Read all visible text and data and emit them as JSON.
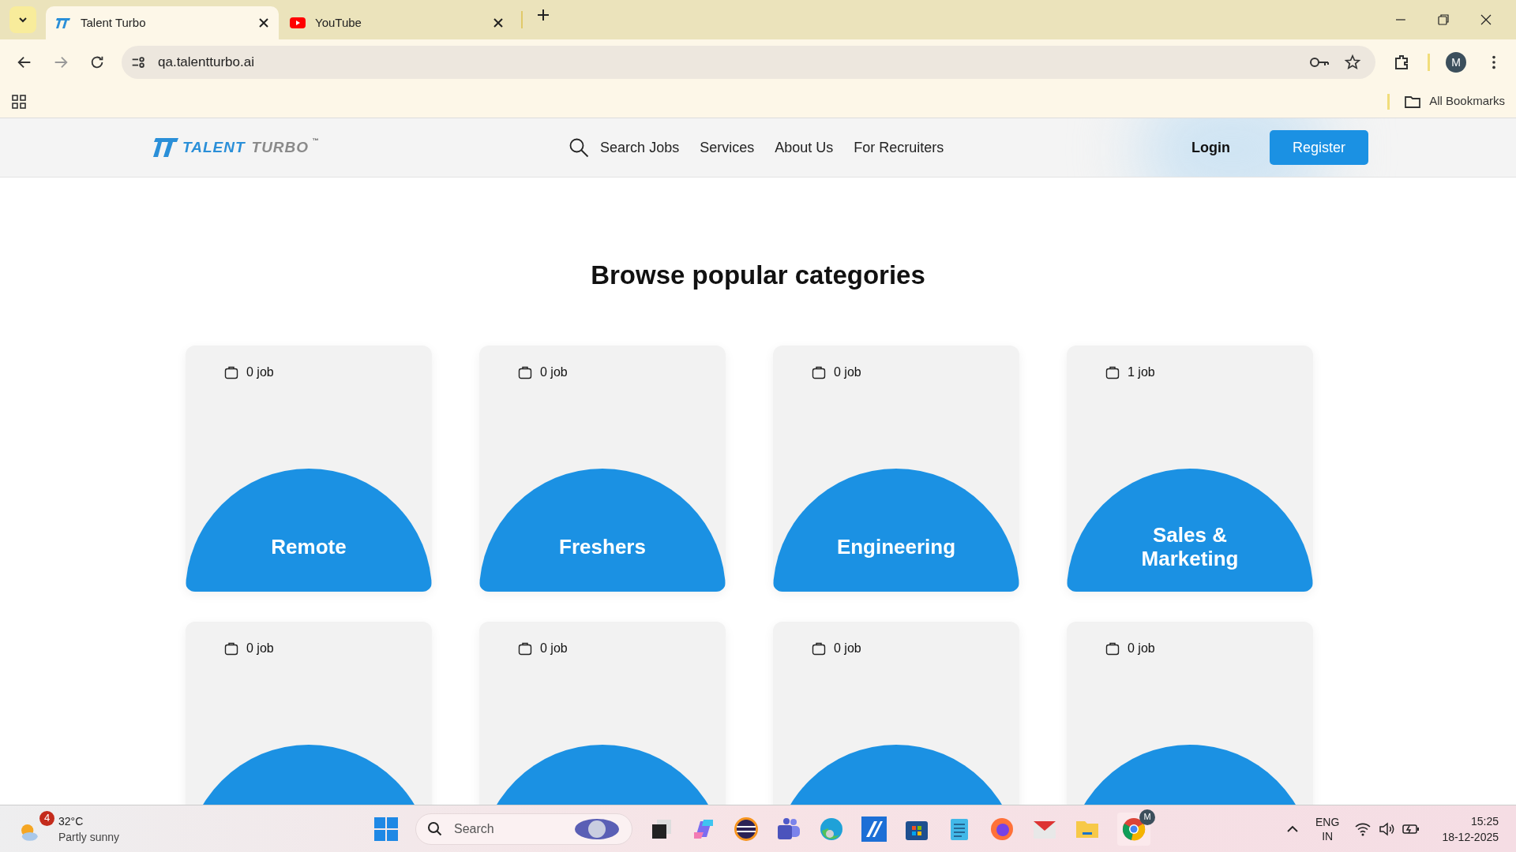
{
  "browser": {
    "tabs": [
      {
        "title": "Talent Turbo",
        "kind": "site",
        "selected": true
      },
      {
        "title": "YouTube",
        "kind": "video",
        "selected": false
      }
    ],
    "url": "qa.talentturbo.ai",
    "bookmarks_label": "All Bookmarks",
    "profile_initial": "M"
  },
  "site": {
    "logo": {
      "word1": "TALENT",
      "word2": "TURBO",
      "mark": "™"
    },
    "nav": [
      {
        "label": "Search Jobs",
        "kind": "search"
      },
      {
        "label": "Services",
        "kind": "link"
      },
      {
        "label": "About Us",
        "kind": "link"
      },
      {
        "label": "For Recruiters",
        "kind": "link"
      }
    ],
    "login": "Login",
    "register": "Register"
  },
  "heading": "Browse popular categories",
  "categories": [
    {
      "jobs": "0 job",
      "name": "Remote"
    },
    {
      "jobs": "0 job",
      "name": "Freshers"
    },
    {
      "jobs": "0 job",
      "name": "Engineering"
    },
    {
      "jobs": "1 job",
      "name": "Sales & Marketing"
    },
    {
      "jobs": "0 job"
    },
    {
      "jobs": "0 job"
    },
    {
      "jobs": "0 job"
    },
    {
      "jobs": "0 job"
    }
  ],
  "taskbar": {
    "weather": {
      "badge": "4",
      "temp": "32°C",
      "desc": "Partly sunny"
    },
    "search": "Search",
    "chrome_badge": "M",
    "lang": "ENG",
    "region": "IN",
    "time": "15:25",
    "date": "18-12-2025"
  }
}
